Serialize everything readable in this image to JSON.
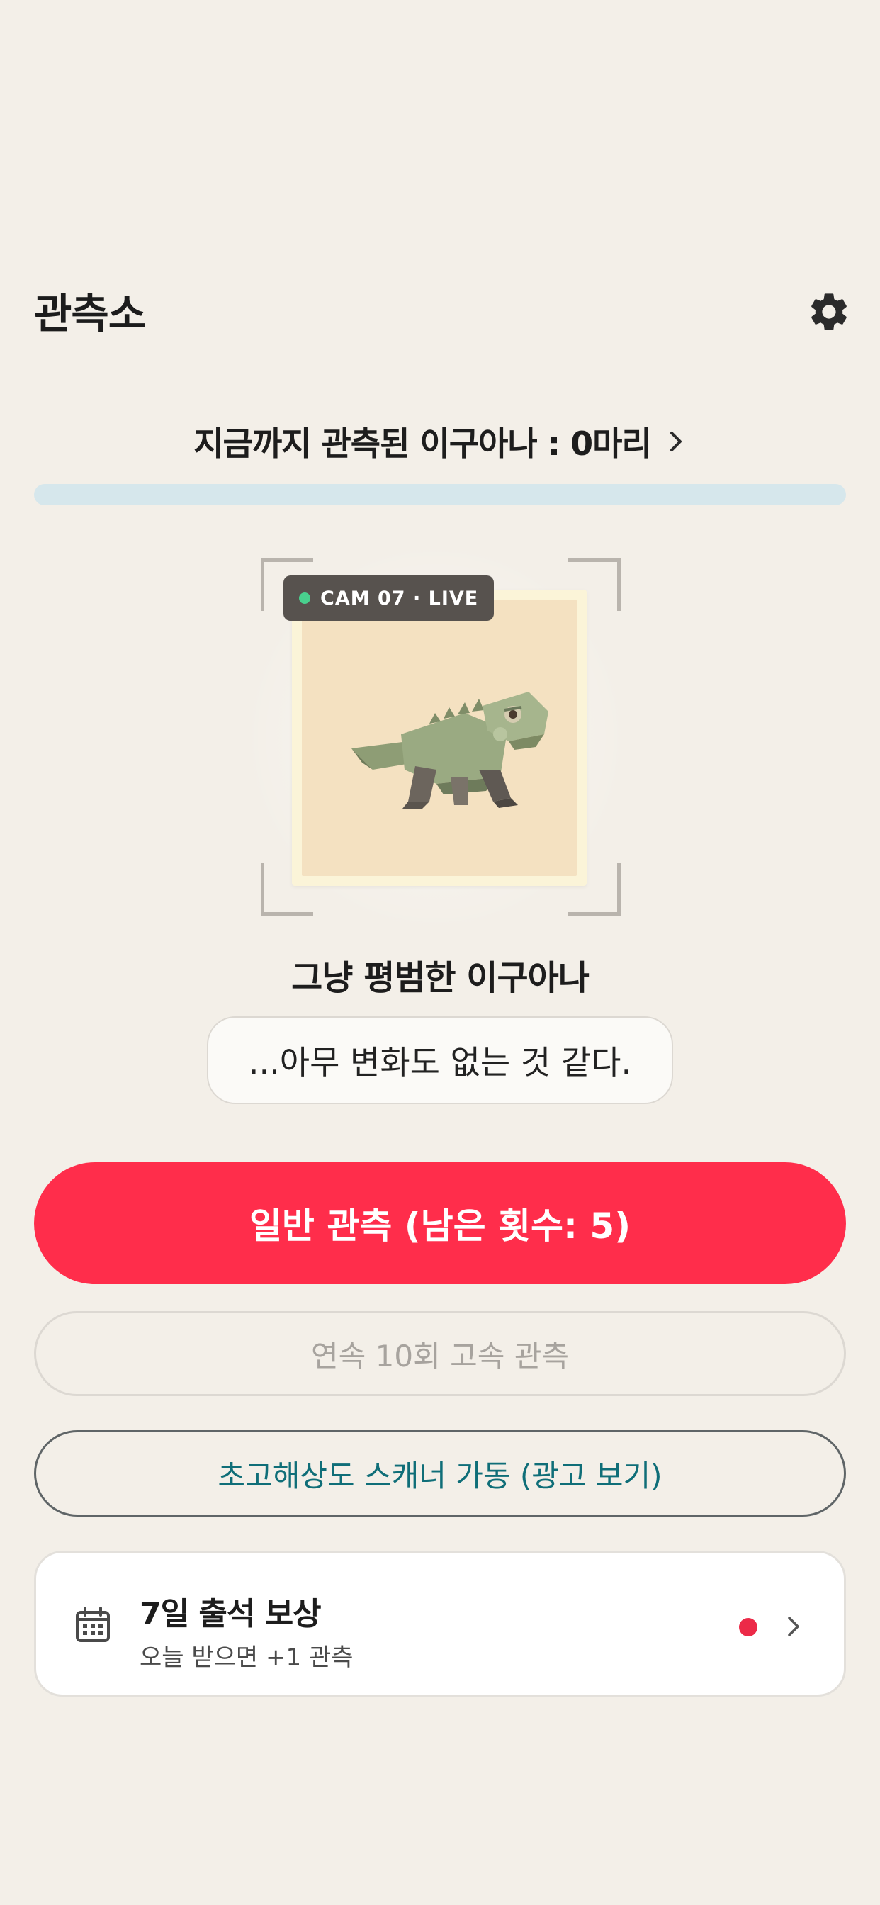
{
  "header": {
    "title": "관측소",
    "settings_icon": "gear-icon"
  },
  "observed": {
    "text": "지금까지 관측된 이구아나 : 0마리",
    "progress_fraction": 0
  },
  "camera": {
    "badge": "CAM 07 · LIVE",
    "live_color": "#49d08e"
  },
  "observation": {
    "species_name": "그냥 평범한 이구아나",
    "message": "...아무 변화도 없는 것 같다."
  },
  "buttons": {
    "normal": "일반 관측 (남은 횟수: 5)",
    "rapid": "연속 10회 고속 관측",
    "scanner": "초고해상도 스캐너 가동 (광고 보기)"
  },
  "attendance": {
    "title": "7일 출석 보상",
    "subtitle": "오늘 받으면 +1 관측",
    "icon": "calendar-icon"
  },
  "colors": {
    "background": "#f3efe8",
    "primary": "#ff2d4b",
    "accent_teal": "#0f6e78",
    "progress_track": "#d6e7ec"
  }
}
